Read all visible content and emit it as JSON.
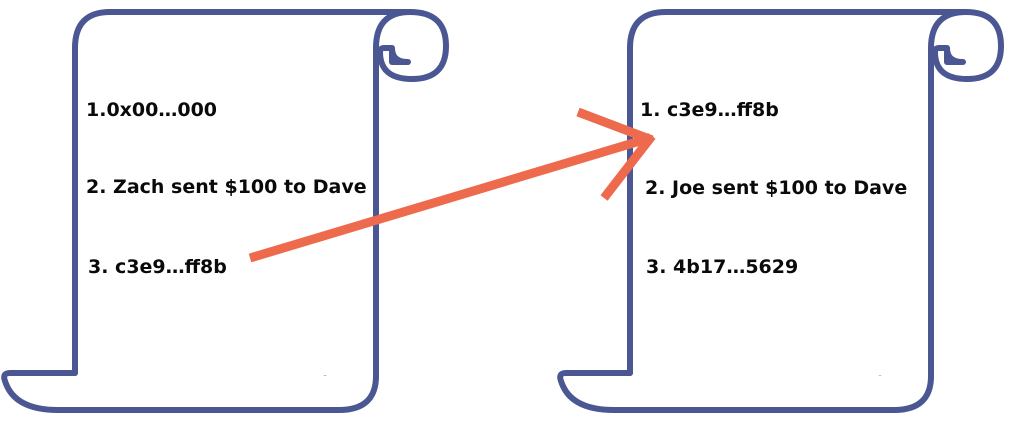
{
  "colors": {
    "scroll_outline": "#4a5793",
    "scroll_fill": "#ffffff",
    "arrow": "#ee6a4d",
    "text": "#0a0a0a"
  },
  "blocks": [
    {
      "lines": [
        "1.0x00…000",
        "2. Zach sent $100 to Dave",
        "3. c3e9…ff8b"
      ]
    },
    {
      "lines": [
        "1. c3e9…ff8b",
        "2. Joe sent $100 to Dave",
        "3. 4b17…5629"
      ]
    }
  ],
  "arrow": {
    "from": "block-1-line-3",
    "to": "block-2-line-1"
  }
}
